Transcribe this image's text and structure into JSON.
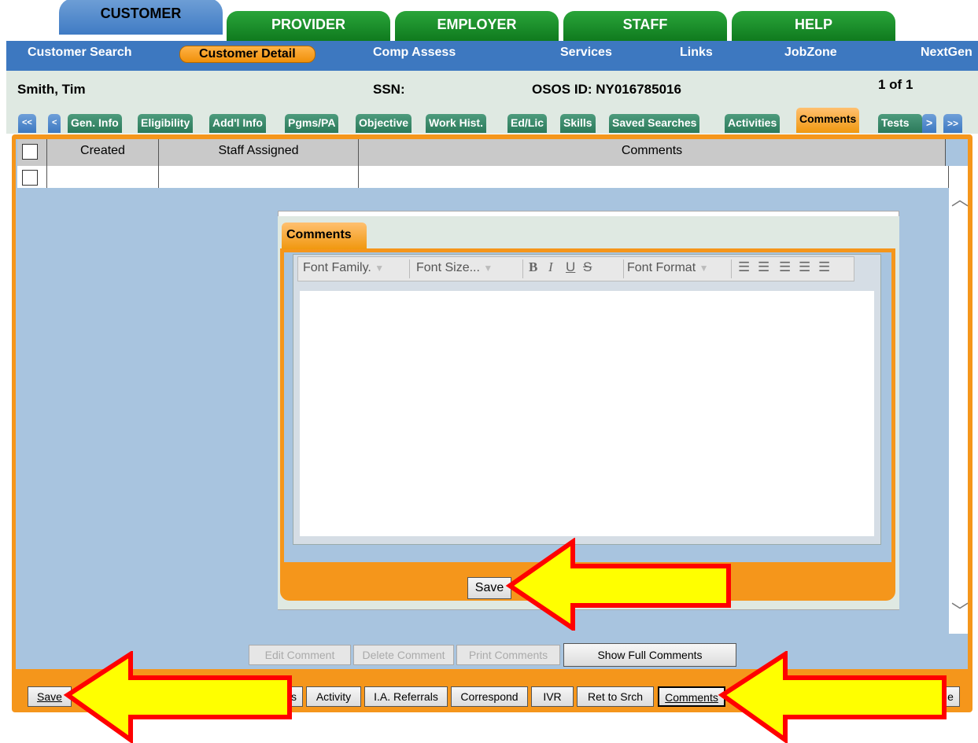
{
  "top_tabs": [
    {
      "label": "CUSTOMER",
      "active": true
    },
    {
      "label": "PROVIDER",
      "active": false
    },
    {
      "label": "EMPLOYER",
      "active": false
    },
    {
      "label": "STAFF",
      "active": false
    },
    {
      "label": "HELP",
      "active": false
    }
  ],
  "subnav": [
    {
      "label": "Customer Search"
    },
    {
      "label": "Customer Detail",
      "active": true
    },
    {
      "label": "Comp Assess"
    },
    {
      "label": "Services"
    },
    {
      "label": "Links"
    },
    {
      "label": "JobZone"
    },
    {
      "label": "NextGen"
    }
  ],
  "customer": {
    "name": "Smith, Tim",
    "ssn_label": "SSN:",
    "osos_id": "OSOS ID: NY016785016",
    "record_count": "1 of 1"
  },
  "subtabs": {
    "first": "<<",
    "prev": "<",
    "items": [
      "Gen. Info",
      "Eligibility",
      "Add'l Info",
      "Pgms/PA",
      "Objective",
      "Work Hist.",
      "Ed/Lic",
      "Skills",
      "Saved Searches",
      "Activities",
      "Comments",
      "Tests"
    ],
    "next": ">",
    "last": ">>"
  },
  "table": {
    "headers": [
      "Created",
      "Staff Assigned",
      "Comments"
    ]
  },
  "dialog": {
    "tab_label": "Comments",
    "toolbar": {
      "font_family": "Font Family.",
      "font_size": "Font Size...",
      "bold": "B",
      "italic": "I",
      "underline": "U",
      "strike": "S",
      "font_format": "Font Format"
    },
    "save_label": "Save"
  },
  "comment_actions": [
    "Edit Comment",
    "Delete Comment",
    "Print Comments",
    "Show Full Comments"
  ],
  "bottom_buttons": {
    "save": "Save",
    "partial_left": "ss",
    "activity": "Activity",
    "ia_referrals": "I.A. Referrals",
    "correspond": "Correspond",
    "ivr": "IVR",
    "ret_to_srch": "Ret to Srch",
    "comments": "Comments",
    "partial_right": "e"
  },
  "colors": {
    "accent_orange": "#f5961b",
    "nav_blue": "#3d78c0",
    "tab_green": "#0f7a1e",
    "arrow_yellow": "#ffff00",
    "arrow_red": "#ff0000"
  }
}
